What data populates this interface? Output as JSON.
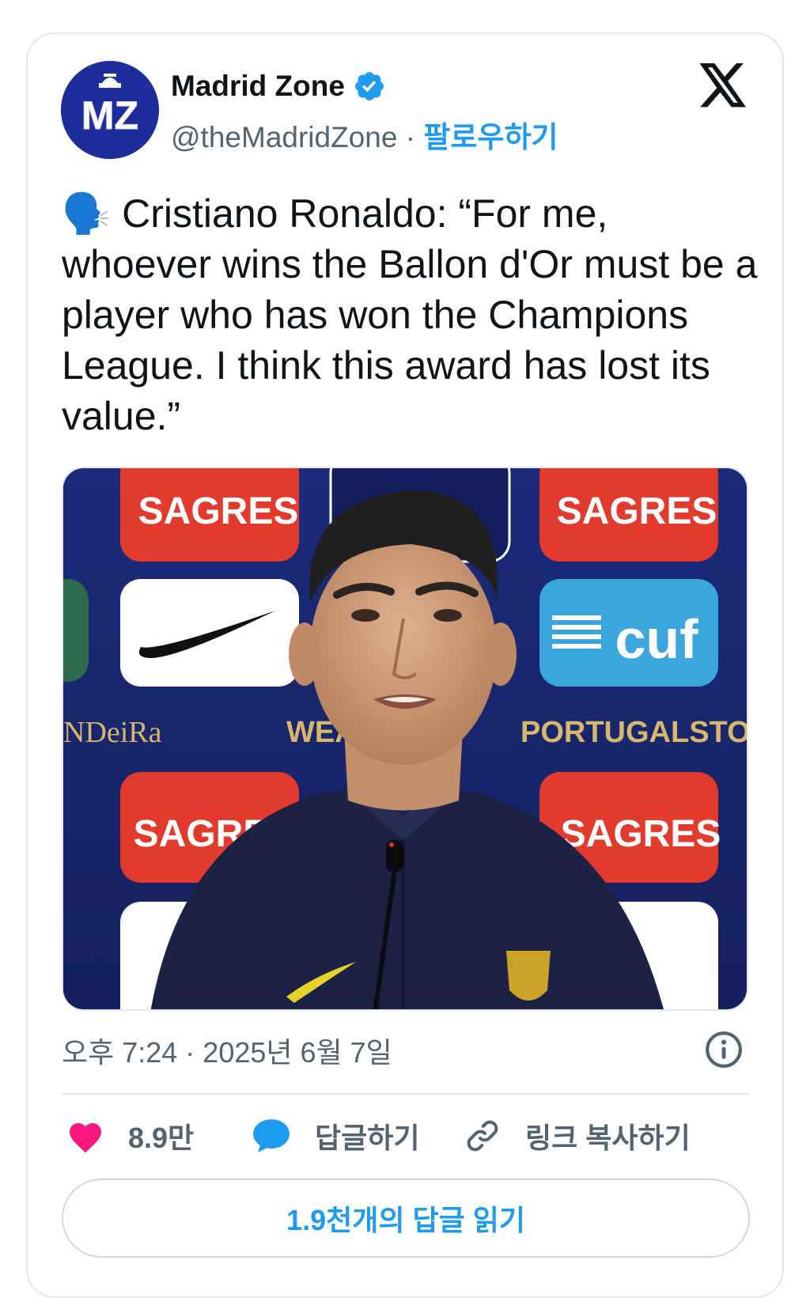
{
  "author": {
    "display_name": "Madrid Zone",
    "handle": "@theMadridZone",
    "separator": "·",
    "follow_label": "팔로우하기",
    "avatar_text": "MZ"
  },
  "tweet": {
    "emoji": "🗣️",
    "text": "Cristiano Ronaldo: “For me, whoever wins the Ballon d'Or must be a player who has won the Champions League. I think this award has lost its value.”",
    "timestamp": "오후 7:24 · 2025년 6월 7일"
  },
  "media": {
    "sponsor_1": "SAGRES",
    "sponsor_2": "SAGRES",
    "sponsor_3": "SAGRES",
    "sponsor_4": "SAGRES",
    "sponsor_cuf": "cuf",
    "banner_left": "NDeiRa",
    "banner_mid": "WEAR",
    "banner_right": "PORTUGALSTORE.FPF."
  },
  "actions": {
    "likes": "8.9만",
    "reply_label": "답글하기",
    "copy_link_label": "링크 복사하기",
    "read_replies_label": "1.9천개의 답글 읽기"
  },
  "icons": {
    "verified": "verified-badge-icon",
    "x_logo": "x-logo-icon",
    "info": "info-icon",
    "like": "heart-icon",
    "reply": "speech-bubble-icon",
    "link": "link-icon"
  },
  "colors": {
    "accent_blue": "#1d9bf0",
    "like_pink": "#f91880",
    "avatar_navy": "#1d2d9b",
    "sponsor_red": "#e23a2d"
  }
}
